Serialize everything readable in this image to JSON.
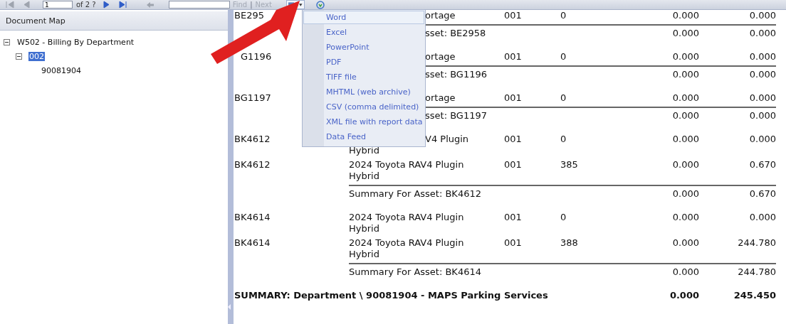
{
  "toolbar": {
    "nav_buttons": [
      {
        "kind": "first",
        "disabled": true
      },
      {
        "kind": "previous",
        "disabled": true
      }
    ],
    "page_field": {
      "value": "1"
    },
    "page_count": "of 2 ?",
    "nav_buttons_after": [
      {
        "kind": "next",
        "disabled": false
      },
      {
        "kind": "last",
        "disabled": false
      }
    ],
    "back_button": {
      "disabled": true
    },
    "find_links": [
      {
        "label": "Find",
        "disabled": true
      },
      {
        "label": "Next",
        "disabled": true
      }
    ],
    "find_separator": "|",
    "export_button": {
      "expanded": true
    }
  },
  "export_menu": {
    "items": [
      {
        "label": "Word",
        "selected": true
      },
      {
        "label": "Excel",
        "selected": false
      },
      {
        "label": "PowerPoint",
        "selected": false
      },
      {
        "label": "PDF",
        "selected": false
      },
      {
        "label": "TIFF file",
        "selected": false
      },
      {
        "label": "MHTML (web archive)",
        "selected": false
      },
      {
        "label": "CSV (comma delimited)",
        "selected": false
      },
      {
        "label": "XML file with report data",
        "selected": false
      },
      {
        "label": "Data Feed",
        "selected": false
      }
    ]
  },
  "document_map": {
    "title": "Document Map",
    "tree": [
      {
        "label": "W502 - Billing By Department",
        "expanded": true,
        "selected": false,
        "children": [
          {
            "label": "002",
            "expanded": true,
            "selected": true,
            "children": [
              {
                "label": "90081904",
                "selected": false
              }
            ]
          }
        ]
      }
    ]
  },
  "report": {
    "groups": [
      {
        "rows": [
          {
            "asset": "BE295",
            "description": [
              "ortage"
            ],
            "clipped": true,
            "column_3": "001",
            "column_4": "0",
            "column_5": "0.000",
            "column_6": "0.000"
          }
        ],
        "summary": {
          "label": "sset: BE2958",
          "clipped": true,
          "column_5": "0.000",
          "column_6": "0.000"
        }
      },
      {
        "rows": [
          {
            "asset": "G1196",
            "asset_covered": true,
            "description": [
              "ortage"
            ],
            "clipped": true,
            "column_3": "001",
            "column_4": "0",
            "column_5": "0.000",
            "column_6": "0.000"
          }
        ],
        "summary": {
          "label": "sset: BG1196",
          "clipped": true,
          "column_5": "0.000",
          "column_6": "0.000"
        }
      },
      {
        "rows": [
          {
            "asset": "BG1197",
            "description": [
              "ortage"
            ],
            "clipped": true,
            "column_3": "001",
            "column_4": "0",
            "column_5": "0.000",
            "column_6": "0.000"
          }
        ],
        "summary": {
          "label": "sset: BG1197",
          "clipped": true,
          "column_5": "0.000",
          "column_6": "0.000"
        }
      },
      {
        "rows": [
          {
            "asset": "BK4612",
            "description": [
              "V4 Plugin",
              "Hybrid"
            ],
            "clipped": true,
            "column_3": "001",
            "column_4": "0",
            "column_5": "0.000",
            "column_6": "0.000"
          },
          {
            "asset": "BK4612",
            "description": [
              "2024 Toyota RAV4 Plugin",
              "Hybrid"
            ],
            "clipped": false,
            "column_3": "001",
            "column_4": "385",
            "column_5": "0.000",
            "column_6": "0.670"
          }
        ],
        "summary": {
          "label": "Summary For Asset: BK4612",
          "column_5": "0.000",
          "column_6": "0.670"
        }
      },
      {
        "rows": [
          {
            "asset": "BK4614",
            "description": [
              "2024 Toyota RAV4 Plugin",
              "Hybrid"
            ],
            "clipped": false,
            "column_3": "001",
            "column_4": "0",
            "column_5": "0.000",
            "column_6": "0.000"
          },
          {
            "asset": "BK4614",
            "description": [
              "2024 Toyota RAV4 Plugin",
              "Hybrid"
            ],
            "clipped": false,
            "column_3": "001",
            "column_4": "388",
            "column_5": "0.000",
            "column_6": "244.780"
          }
        ],
        "summary": {
          "label": "Summary For Asset: BK4614",
          "column_5": "0.000",
          "column_6": "244.780"
        }
      }
    ],
    "total": {
      "label": "SUMMARY: Department \\ 90081904 - MAPS Parking Services",
      "column_5": "0.000",
      "column_6": "245.450"
    }
  }
}
